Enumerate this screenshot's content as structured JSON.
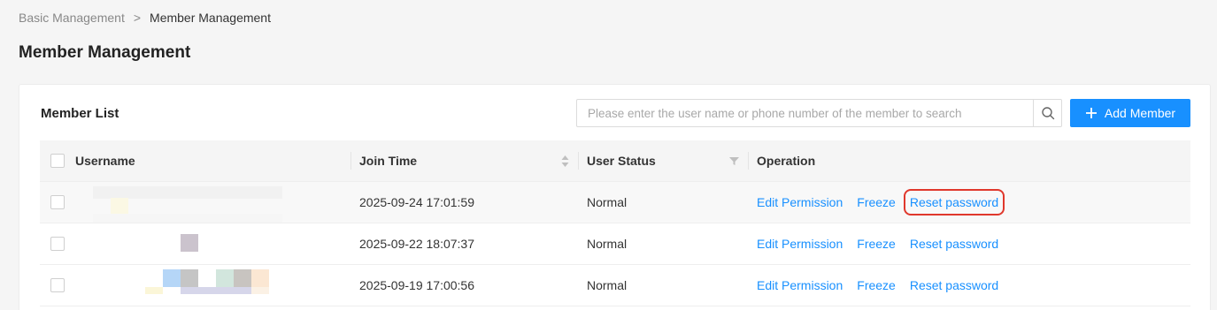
{
  "breadcrumb": {
    "parent": "Basic Management",
    "separator": ">",
    "current": "Member Management"
  },
  "page_title": "Member Management",
  "card": {
    "title": "Member List",
    "search_placeholder": "Please enter the user name or phone number of the member to search",
    "search_icon": "search-icon",
    "add_button_label": "Add Member",
    "add_icon": "plus-icon"
  },
  "table": {
    "columns": {
      "username": "Username",
      "join_time": "Join Time",
      "user_status": "User Status",
      "operation": "Operation"
    },
    "rows": [
      {
        "username": "",
        "join_time": "2025-09-24 17:01:59",
        "status": "Normal"
      },
      {
        "username": "",
        "join_time": "2025-09-22 18:07:37",
        "status": "Normal"
      },
      {
        "username": "",
        "join_time": "2025-09-19 17:00:56",
        "status": "Normal"
      }
    ],
    "actions": {
      "edit": "Edit Permission",
      "freeze": "Freeze",
      "reset": "Reset password"
    }
  },
  "colors": {
    "accent": "#1890ff",
    "highlight_box": "#e0382c"
  }
}
